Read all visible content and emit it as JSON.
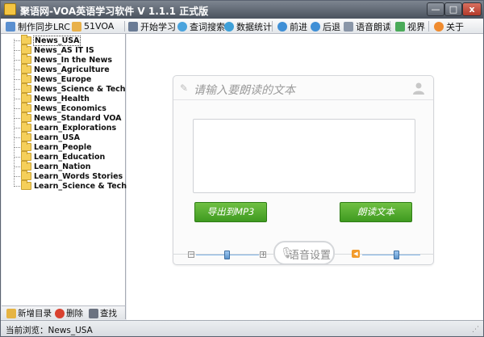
{
  "window": {
    "title": "聚语网-VOA英语学习软件 V 1.1.1 正式版",
    "min_glyph": "—",
    "max_glyph": "□",
    "close_glyph": "x"
  },
  "toolbar": {
    "items": [
      {
        "label": "制作同步LRC",
        "icon": "lrc-icon"
      },
      {
        "label": "51VOA",
        "icon": "home-icon"
      },
      {
        "label": "开始学习",
        "icon": "book-icon"
      },
      {
        "label": "查词搜索",
        "icon": "search-icon"
      },
      {
        "label": "数据统计",
        "icon": "chart-icon"
      },
      {
        "label": "前进",
        "icon": "forward-icon"
      },
      {
        "label": "后退",
        "icon": "back-icon"
      },
      {
        "label": "语音朗读",
        "icon": "speaker-icon"
      },
      {
        "label": "视界",
        "icon": "view-icon"
      },
      {
        "label": "关于",
        "icon": "info-icon"
      }
    ]
  },
  "tree": {
    "items": [
      "News_USA",
      "News_AS IT IS",
      "News_In the News",
      "News_Agriculture",
      "News_Europe",
      "News_Science & Tech",
      "News_Health",
      "News_Economics",
      "News_Standard VOA",
      "Learn_Explorations",
      "Learn_USA",
      "Learn_People",
      "Learn_Education",
      "Learn_Nation",
      "Learn_Words Stories",
      "Learn_Science & Tech"
    ],
    "selected": "News_USA",
    "bottom": {
      "add_label": "新增目录",
      "delete_label": "删除",
      "find_label": "查找"
    }
  },
  "status": {
    "text": "当前浏览：News_USA"
  },
  "reader": {
    "title": "请输入要朗读的文本",
    "text_value": "",
    "export_label": "导出到MP3",
    "read_label": "朗读文本",
    "voice_settings_label": "语音设置",
    "speed_slider_value": 0.5,
    "volume_slider_value": 0.6
  },
  "colors": {
    "accent_green": "#3f9a20",
    "slider_blue": "#5c94cc",
    "speaker_orange": "#f29b2b"
  }
}
